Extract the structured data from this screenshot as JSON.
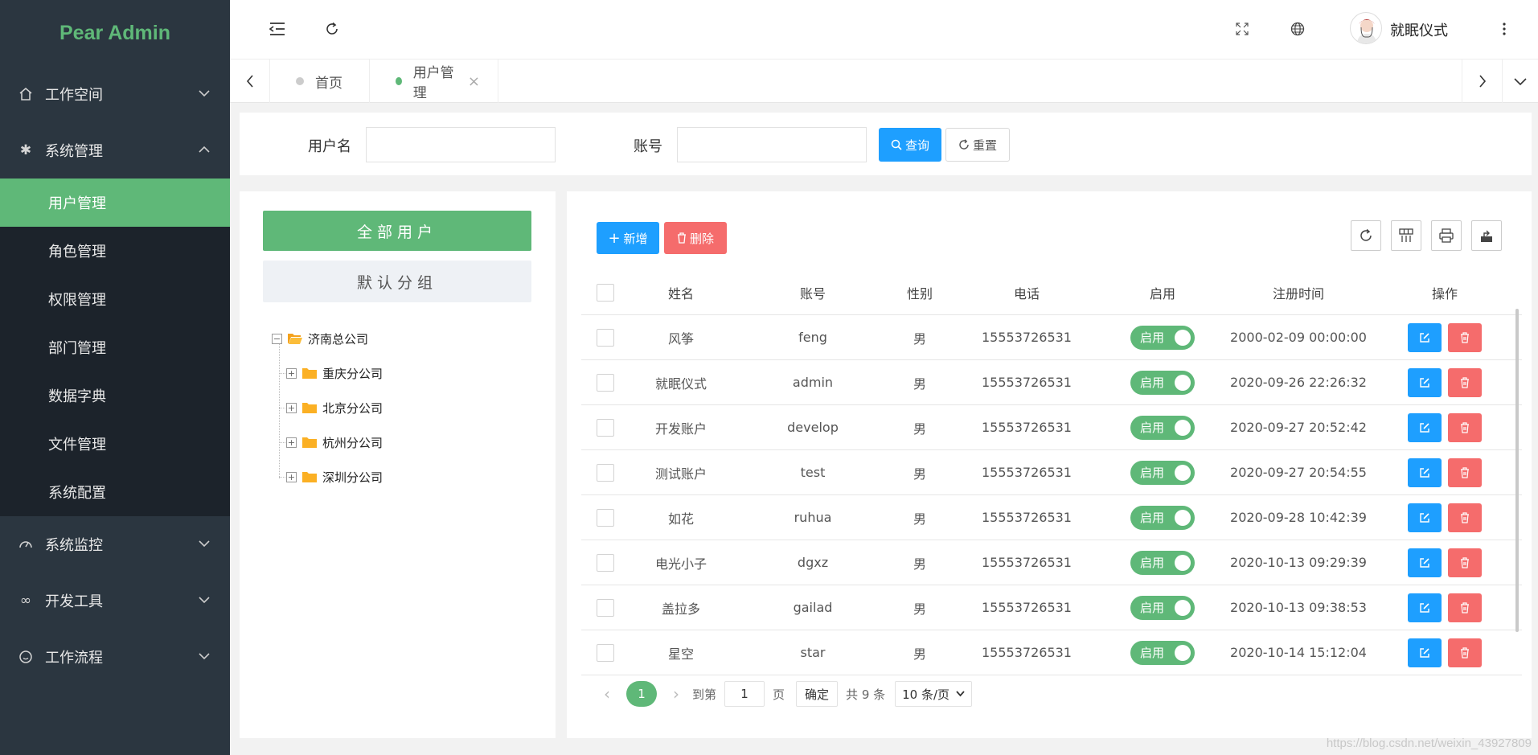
{
  "app": {
    "logo": "Pear Admin"
  },
  "sidebar": {
    "workspace": "工作空间",
    "system": "系统管理",
    "sub_items": [
      {
        "label": "用户管理",
        "active": true
      },
      {
        "label": "角色管理"
      },
      {
        "label": "权限管理"
      },
      {
        "label": "部门管理"
      },
      {
        "label": "数据字典"
      },
      {
        "label": "文件管理"
      },
      {
        "label": "系统配置"
      }
    ],
    "monitor": "系统监控",
    "devtools": "开发工具",
    "workflow": "工作流程"
  },
  "header": {
    "user_name": "就眠仪式"
  },
  "tabs": [
    {
      "label": "首页"
    },
    {
      "label": "用户管理",
      "active": true
    }
  ],
  "search": {
    "username_label": "用户名",
    "username_value": "",
    "account_label": "账号",
    "account_value": "",
    "query_button": "查询",
    "reset_button": "重置"
  },
  "tree": {
    "all_users_button": "全部用户",
    "default_group_button": "默认分组",
    "root": "济南总公司",
    "children": [
      "重庆分公司",
      "北京分公司",
      "杭州分公司",
      "深圳分公司"
    ]
  },
  "toolbar": {
    "add_button": "新增",
    "delete_button": "删除"
  },
  "table": {
    "headers": {
      "name": "姓名",
      "account": "账号",
      "gender": "性别",
      "phone": "电话",
      "enabled": "启用",
      "registered": "注册时间",
      "actions": "操作"
    },
    "switch_label": "启用",
    "rows": [
      {
        "name": "风筝",
        "account": "feng",
        "gender": "男",
        "phone": "15553726531",
        "enabled": true,
        "registered": "2000-02-09 00:00:00"
      },
      {
        "name": "就眠仪式",
        "account": "admin",
        "gender": "男",
        "phone": "15553726531",
        "enabled": true,
        "registered": "2020-09-26 22:26:32"
      },
      {
        "name": "开发账户",
        "account": "develop",
        "gender": "男",
        "phone": "15553726531",
        "enabled": true,
        "registered": "2020-09-27 20:52:42"
      },
      {
        "name": "测试账户",
        "account": "test",
        "gender": "男",
        "phone": "15553726531",
        "enabled": true,
        "registered": "2020-09-27 20:54:55"
      },
      {
        "name": "如花",
        "account": "ruhua",
        "gender": "男",
        "phone": "15553726531",
        "enabled": true,
        "registered": "2020-09-28 10:42:39"
      },
      {
        "name": "电光小子",
        "account": "dgxz",
        "gender": "男",
        "phone": "15553726531",
        "enabled": true,
        "registered": "2020-10-13 09:29:39"
      },
      {
        "name": "盖拉多",
        "account": "gailad",
        "gender": "男",
        "phone": "15553726531",
        "enabled": true,
        "registered": "2020-10-13 09:38:53"
      },
      {
        "name": "星空",
        "account": "star",
        "gender": "男",
        "phone": "15553726531",
        "enabled": true,
        "registered": "2020-10-14 15:12:04"
      }
    ]
  },
  "pagination": {
    "current_page": "1",
    "goto_label": "到第",
    "goto_value": "1",
    "page_label": "页",
    "confirm_button": "确定",
    "total_text": "共 9 条",
    "page_size": "10 条/页"
  },
  "watermark": "https://blog.csdn.net/weixin_43927809",
  "colors": {
    "sidebar_bg": "#2b3640",
    "submenu_bg": "#1c232b",
    "accent_green": "#5fb878",
    "primary_blue": "#1e9fff",
    "danger_red": "#ff5722"
  }
}
